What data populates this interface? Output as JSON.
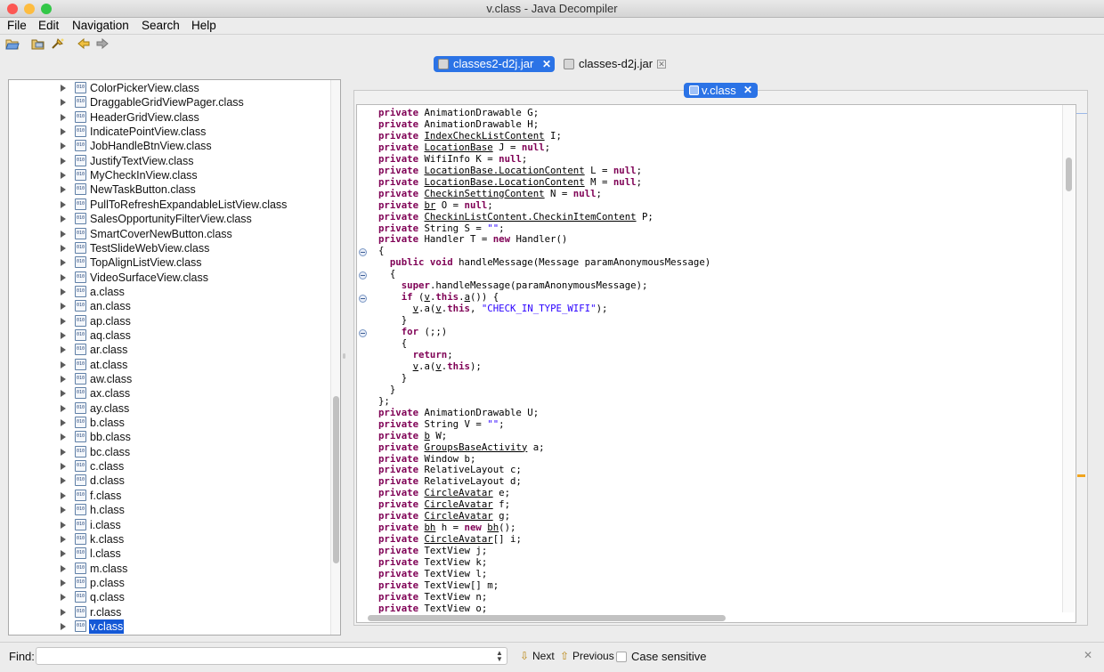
{
  "window": {
    "title": "v.class - Java Decompiler",
    "traffic_colors": [
      "#fc5753",
      "#fdbc40",
      "#33c748"
    ]
  },
  "menu": [
    "File",
    "Edit",
    "Navigation",
    "Search",
    "Help"
  ],
  "toolbar": {
    "icons": [
      "open-file-icon",
      "open-folder-icon",
      "open-type-icon",
      "back-arrow-icon",
      "forward-arrow-icon"
    ]
  },
  "file_tabs": [
    {
      "label": "classes2-d2j.jar",
      "active": true
    },
    {
      "label": "classes-d2j.jar",
      "active": false
    }
  ],
  "tree": {
    "items": [
      {
        "label": "ColorPickerView.class"
      },
      {
        "label": "DraggableGridViewPager.class"
      },
      {
        "label": "HeaderGridView.class"
      },
      {
        "label": "IndicatePointView.class"
      },
      {
        "label": "JobHandleBtnView.class"
      },
      {
        "label": "JustifyTextView.class"
      },
      {
        "label": "MyCheckInView.class"
      },
      {
        "label": "NewTaskButton.class"
      },
      {
        "label": "PullToRefreshExpandableListView.class"
      },
      {
        "label": "SalesOpportunityFilterView.class"
      },
      {
        "label": "SmartCoverNewButton.class"
      },
      {
        "label": "TestSlideWebView.class"
      },
      {
        "label": "TopAlignListView.class"
      },
      {
        "label": "VideoSurfaceView.class"
      },
      {
        "label": "a.class"
      },
      {
        "label": "an.class"
      },
      {
        "label": "ap.class"
      },
      {
        "label": "aq.class"
      },
      {
        "label": "ar.class"
      },
      {
        "label": "at.class"
      },
      {
        "label": "aw.class"
      },
      {
        "label": "ax.class"
      },
      {
        "label": "ay.class"
      },
      {
        "label": "b.class"
      },
      {
        "label": "bb.class"
      },
      {
        "label": "bc.class"
      },
      {
        "label": "c.class"
      },
      {
        "label": "d.class"
      },
      {
        "label": "f.class"
      },
      {
        "label": "h.class"
      },
      {
        "label": "i.class"
      },
      {
        "label": "k.class"
      },
      {
        "label": "l.class"
      },
      {
        "label": "m.class"
      },
      {
        "label": "p.class"
      },
      {
        "label": "q.class"
      },
      {
        "label": "r.class"
      },
      {
        "label": "v.class",
        "selected": true
      }
    ],
    "class_icon_text": "010"
  },
  "editor": {
    "tab_label": "v.class",
    "lines": [
      [
        [
          "kw",
          "private"
        ],
        [
          "t",
          " AnimationDrawable G;"
        ]
      ],
      [
        [
          "kw",
          "private"
        ],
        [
          "t",
          " AnimationDrawable H;"
        ]
      ],
      [
        [
          "kw",
          "private"
        ],
        [
          "t",
          " "
        ],
        [
          "u",
          "IndexCheckListContent"
        ],
        [
          "t",
          " I;"
        ]
      ],
      [
        [
          "kw",
          "private"
        ],
        [
          "t",
          " "
        ],
        [
          "u",
          "LocationBase"
        ],
        [
          "t",
          " J = "
        ],
        [
          "kw",
          "null"
        ],
        [
          "t",
          ";"
        ]
      ],
      [
        [
          "kw",
          "private"
        ],
        [
          "t",
          " WifiInfo K = "
        ],
        [
          "kw",
          "null"
        ],
        [
          "t",
          ";"
        ]
      ],
      [
        [
          "kw",
          "private"
        ],
        [
          "t",
          " "
        ],
        [
          "u",
          "LocationBase.LocationContent"
        ],
        [
          "t",
          " L = "
        ],
        [
          "kw",
          "null"
        ],
        [
          "t",
          ";"
        ]
      ],
      [
        [
          "kw",
          "private"
        ],
        [
          "t",
          " "
        ],
        [
          "u",
          "LocationBase.LocationContent"
        ],
        [
          "t",
          " M = "
        ],
        [
          "kw",
          "null"
        ],
        [
          "t",
          ";"
        ]
      ],
      [
        [
          "kw",
          "private"
        ],
        [
          "t",
          " "
        ],
        [
          "u",
          "CheckinSettingContent"
        ],
        [
          "t",
          " N = "
        ],
        [
          "kw",
          "null"
        ],
        [
          "t",
          ";"
        ]
      ],
      [
        [
          "kw",
          "private"
        ],
        [
          "t",
          " "
        ],
        [
          "u",
          "br"
        ],
        [
          "t",
          " O = "
        ],
        [
          "kw",
          "null"
        ],
        [
          "t",
          ";"
        ]
      ],
      [
        [
          "kw",
          "private"
        ],
        [
          "t",
          " "
        ],
        [
          "u",
          "CheckinListContent.CheckinItemContent"
        ],
        [
          "t",
          " P;"
        ]
      ],
      [
        [
          "kw",
          "private"
        ],
        [
          "t",
          " String S = "
        ],
        [
          "str",
          "\"\""
        ],
        [
          "t",
          ";"
        ]
      ],
      [
        [
          "kw",
          "private"
        ],
        [
          "t",
          " Handler T = "
        ],
        [
          "kw",
          "new"
        ],
        [
          "t",
          " Handler()"
        ]
      ],
      [
        [
          "t",
          "{"
        ]
      ],
      [
        [
          "t",
          "  "
        ],
        [
          "kw",
          "public void"
        ],
        [
          "t",
          " handleMessage(Message paramAnonymousMessage)"
        ]
      ],
      [
        [
          "t",
          "  {"
        ]
      ],
      [
        [
          "t",
          "    "
        ],
        [
          "kw",
          "super"
        ],
        [
          "t",
          ".handleMessage(paramAnonymousMessage);"
        ]
      ],
      [
        [
          "t",
          "    "
        ],
        [
          "kw",
          "if"
        ],
        [
          "t",
          " ("
        ],
        [
          "u",
          "v"
        ],
        [
          "t",
          "."
        ],
        [
          "kw",
          "this"
        ],
        [
          "t",
          "."
        ],
        [
          "u",
          "a"
        ],
        [
          "t",
          "()) {"
        ]
      ],
      [
        [
          "t",
          "      "
        ],
        [
          "u",
          "v"
        ],
        [
          "t",
          ".a("
        ],
        [
          "u",
          "v"
        ],
        [
          "t",
          "."
        ],
        [
          "kw",
          "this"
        ],
        [
          "t",
          ", "
        ],
        [
          "str",
          "\"CHECK_IN_TYPE_WIFI\""
        ],
        [
          "t",
          ");"
        ]
      ],
      [
        [
          "t",
          "    }"
        ]
      ],
      [
        [
          "t",
          "    "
        ],
        [
          "kw",
          "for"
        ],
        [
          "t",
          " (;;)"
        ]
      ],
      [
        [
          "t",
          "    {"
        ]
      ],
      [
        [
          "t",
          "      "
        ],
        [
          "kw",
          "return"
        ],
        [
          "t",
          ";"
        ]
      ],
      [
        [
          "t",
          "      "
        ],
        [
          "u",
          "v"
        ],
        [
          "t",
          ".a("
        ],
        [
          "u",
          "v"
        ],
        [
          "t",
          "."
        ],
        [
          "kw",
          "this"
        ],
        [
          "t",
          ");"
        ]
      ],
      [
        [
          "t",
          "    }"
        ]
      ],
      [
        [
          "t",
          "  }"
        ]
      ],
      [
        [
          "t",
          "};"
        ]
      ],
      [
        [
          "kw",
          "private"
        ],
        [
          "t",
          " AnimationDrawable U;"
        ]
      ],
      [
        [
          "kw",
          "private"
        ],
        [
          "t",
          " String V = "
        ],
        [
          "str",
          "\"\""
        ],
        [
          "t",
          ";"
        ]
      ],
      [
        [
          "kw",
          "private"
        ],
        [
          "t",
          " "
        ],
        [
          "u",
          "b"
        ],
        [
          "t",
          " W;"
        ]
      ],
      [
        [
          "kw",
          "private"
        ],
        [
          "t",
          " "
        ],
        [
          "u",
          "GroupsBaseActivity"
        ],
        [
          "t",
          " a;"
        ]
      ],
      [
        [
          "kw",
          "private"
        ],
        [
          "t",
          " Window b;"
        ]
      ],
      [
        [
          "kw",
          "private"
        ],
        [
          "t",
          " RelativeLayout c;"
        ]
      ],
      [
        [
          "kw",
          "private"
        ],
        [
          "t",
          " RelativeLayout d;"
        ]
      ],
      [
        [
          "kw",
          "private"
        ],
        [
          "t",
          " "
        ],
        [
          "u",
          "CircleAvatar"
        ],
        [
          "t",
          " e;"
        ]
      ],
      [
        [
          "kw",
          "private"
        ],
        [
          "t",
          " "
        ],
        [
          "u",
          "CircleAvatar"
        ],
        [
          "t",
          " f;"
        ]
      ],
      [
        [
          "kw",
          "private"
        ],
        [
          "t",
          " "
        ],
        [
          "u",
          "CircleAvatar"
        ],
        [
          "t",
          " g;"
        ]
      ],
      [
        [
          "kw",
          "private"
        ],
        [
          "t",
          " "
        ],
        [
          "u",
          "bh"
        ],
        [
          "t",
          " h = "
        ],
        [
          "kw",
          "new"
        ],
        [
          "t",
          " "
        ],
        [
          "u",
          "bh"
        ],
        [
          "t",
          "();"
        ]
      ],
      [
        [
          "kw",
          "private"
        ],
        [
          "t",
          " "
        ],
        [
          "u",
          "CircleAvatar"
        ],
        [
          "t",
          "[] i;"
        ]
      ],
      [
        [
          "kw",
          "private"
        ],
        [
          "t",
          " TextView j;"
        ]
      ],
      [
        [
          "kw",
          "private"
        ],
        [
          "t",
          " TextView k;"
        ]
      ],
      [
        [
          "kw",
          "private"
        ],
        [
          "t",
          " TextView l;"
        ]
      ],
      [
        [
          "kw",
          "private"
        ],
        [
          "t",
          " TextView[] m;"
        ]
      ],
      [
        [
          "kw",
          "private"
        ],
        [
          "t",
          " TextView n;"
        ]
      ],
      [
        [
          "kw",
          "private"
        ],
        [
          "t",
          " TextView o;"
        ]
      ]
    ],
    "fold_lines": [
      12,
      14,
      16,
      19
    ]
  },
  "find_bar": {
    "label": "Find:",
    "value": "",
    "placeholder": "",
    "next_label": "Next",
    "previous_label": "Previous",
    "case_label": "Case sensitive",
    "case_checked": false
  }
}
